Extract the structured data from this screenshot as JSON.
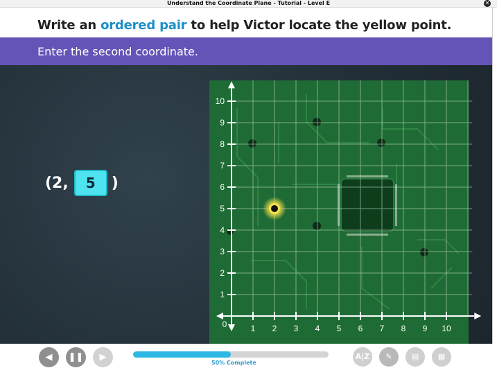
{
  "window": {
    "title": "Understand the Coordinate Plane - Tutorial - Level E",
    "close_icon": "close-icon"
  },
  "question": {
    "prefix": "Write an ",
    "highlight": "ordered pair",
    "suffix": " to help Victor locate the yellow point."
  },
  "instruction": "Enter the second coordinate.",
  "answer": {
    "open": "(2,",
    "value": "5",
    "close": ")"
  },
  "plane": {
    "x_axis_label": "x",
    "y_axis_label": "y",
    "origin_label": "0",
    "x_ticks": [
      "1",
      "2",
      "3",
      "4",
      "5",
      "6",
      "7",
      "8",
      "9",
      "10"
    ],
    "y_ticks": [
      "1",
      "2",
      "3",
      "4",
      "5",
      "6",
      "7",
      "8",
      "9",
      "10"
    ],
    "highlighted_point": {
      "x": 2,
      "y": 5,
      "color": "#f5e14a"
    },
    "board_color": "#1f6b35"
  },
  "footer": {
    "progress_percent": 50,
    "progress_text": "50% Complete",
    "nav": {
      "back_icon": "arrow-left-icon",
      "pause_icon": "pause-icon",
      "forward_icon": "arrow-right-icon"
    },
    "tools": {
      "glossary_label": "A|Z",
      "glossary_icon": "glossary-icon",
      "pencil_icon": "pencil-icon",
      "notes_icon": "notebook-icon",
      "calculator_icon": "calculator-icon"
    }
  },
  "colors": {
    "accent_purple": "#6554b7",
    "highlight_blue": "#1a8fc8",
    "input_cyan": "#4fe3f0",
    "progress": "#2fb8e4",
    "nav_gray": "#9a9a9a"
  }
}
